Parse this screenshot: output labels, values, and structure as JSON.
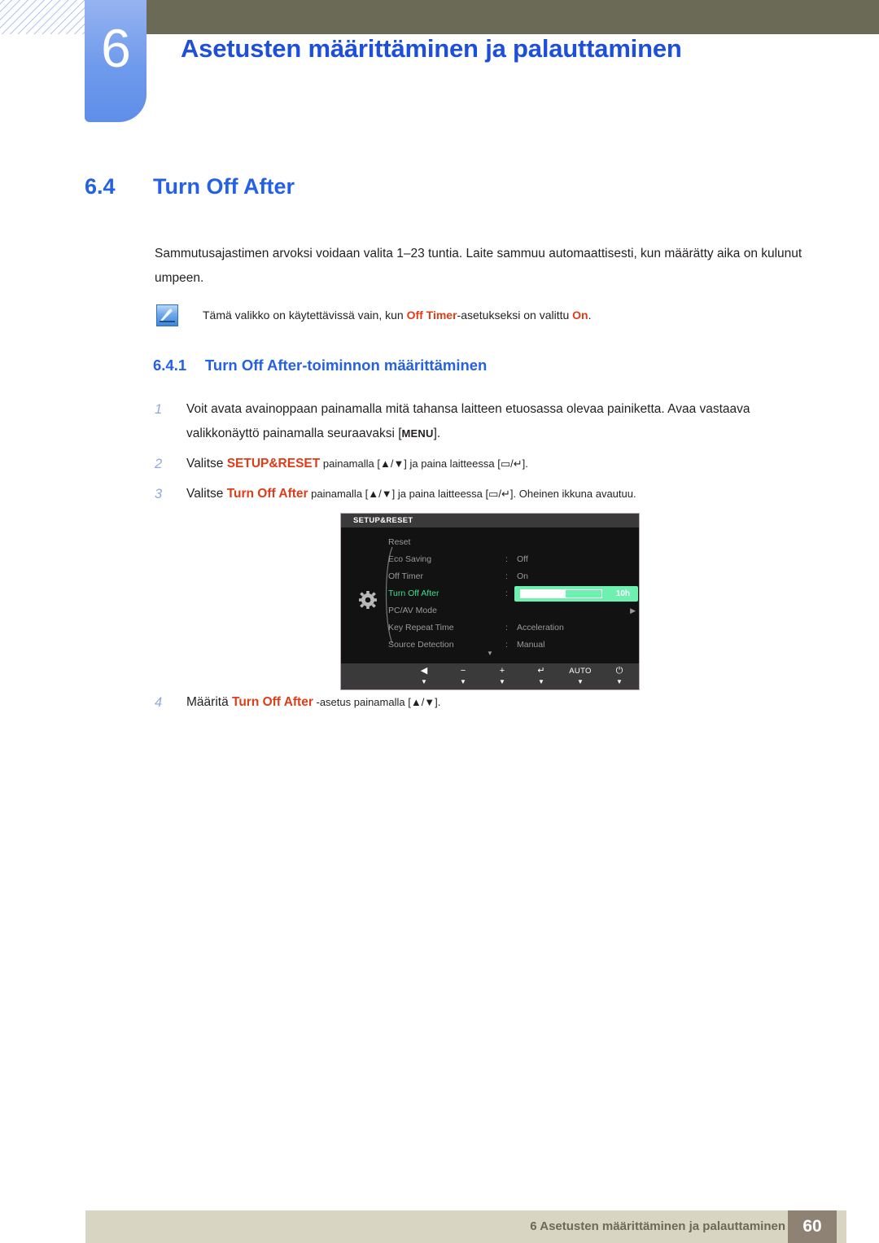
{
  "header": {
    "chapter_number": "6",
    "chapter_title": "Asetusten määrittäminen ja palauttaminen"
  },
  "section": {
    "number": "6.4",
    "title": "Turn Off After",
    "paragraph": "Sammutusajastimen arvoksi voidaan valita 1–23 tuntia. Laite sammuu automaattisesti, kun määrätty aika on kulunut umpeen."
  },
  "note": {
    "icon": "note-pencil-icon",
    "text_before": "Tämä valikko on käytettävissä vain, kun ",
    "highlight1": "Off Timer",
    "text_mid": "-asetukseksi on valittu ",
    "highlight2": "On",
    "text_after": "."
  },
  "subsection": {
    "number": "6.4.1",
    "title": "Turn Off After-toiminnon määrittäminen"
  },
  "steps": [
    {
      "index": "1",
      "parts": [
        {
          "t": "text",
          "v": "Voit avata avainoppaan painamalla mitä tahansa laitteen etuosassa olevaa painiketta. Avaa vastaava valikkonäyttö painamalla seuraavaksi ["
        },
        {
          "t": "kbd",
          "v": "MENU"
        },
        {
          "t": "text",
          "v": "]."
        }
      ]
    },
    {
      "index": "2",
      "parts": [
        {
          "t": "text",
          "v": "Valitse "
        },
        {
          "t": "hl",
          "v": "SETUP&RESET"
        },
        {
          "t": "text",
          "v": " painamalla [▲/▼] ja paina laitteessa [▭/↵]."
        }
      ]
    },
    {
      "index": "3",
      "parts": [
        {
          "t": "text",
          "v": "Valitse "
        },
        {
          "t": "hl",
          "v": "Turn Off After"
        },
        {
          "t": "text",
          "v": " painamalla [▲/▼] ja paina laitteessa [▭/↵]. Oheinen ikkuna avautuu."
        }
      ]
    }
  ],
  "step4": {
    "index": "4",
    "before": "Määritä ",
    "highlight": "Turn Off After",
    "after": " -asetus painamalla [▲/▼]."
  },
  "osd": {
    "title": "SETUP&RESET",
    "menu_icon": "gear-icon",
    "rows": [
      {
        "label": "Reset",
        "colon": "",
        "value": "",
        "type": "plain",
        "active": false
      },
      {
        "label": "Eco Saving",
        "colon": ":",
        "value": "Off",
        "type": "plain",
        "active": false
      },
      {
        "label": "Off Timer",
        "colon": ":",
        "value": "On",
        "type": "plain",
        "active": false
      },
      {
        "label": "Turn Off After",
        "colon": ":",
        "value": "10h",
        "type": "slider",
        "active": true
      },
      {
        "label": "PC/AV Mode",
        "colon": "",
        "value": "",
        "type": "submenu",
        "active": false
      },
      {
        "label": "Key Repeat Time",
        "colon": ":",
        "value": "Acceleration",
        "type": "plain",
        "active": false
      },
      {
        "label": "Source Detection",
        "colon": ":",
        "value": "Manual",
        "type": "plain",
        "active": false
      }
    ],
    "slider": {
      "value_label": "10h",
      "fill_percent": 56
    },
    "scroll_down_indicator": "▼",
    "buttons": [
      {
        "name": "back-button",
        "glyph": "◀",
        "caret": "▼"
      },
      {
        "name": "minus-button",
        "glyph": "−",
        "caret": "▼"
      },
      {
        "name": "plus-button",
        "glyph": "+",
        "caret": "▼"
      },
      {
        "name": "enter-button",
        "glyph": "↵",
        "caret": "▼"
      },
      {
        "name": "auto-button",
        "glyph": "AUTO",
        "caret": "▼"
      },
      {
        "name": "power-button",
        "glyph": "⏻",
        "caret": "▼"
      }
    ]
  },
  "footer": {
    "text": "6 Asetusten määrittäminen ja palauttaminen",
    "page": "60"
  },
  "colors": {
    "heading_blue": "#2460e8",
    "chapter_blue": "#1d4fdb",
    "highlight_red": "#e03c18",
    "olive": "#6b6a57",
    "footer_bar": "#d9d5c3",
    "page_box": "#8d8274",
    "osd_green": "#39e08e",
    "slider_green": "#6df0b0"
  }
}
